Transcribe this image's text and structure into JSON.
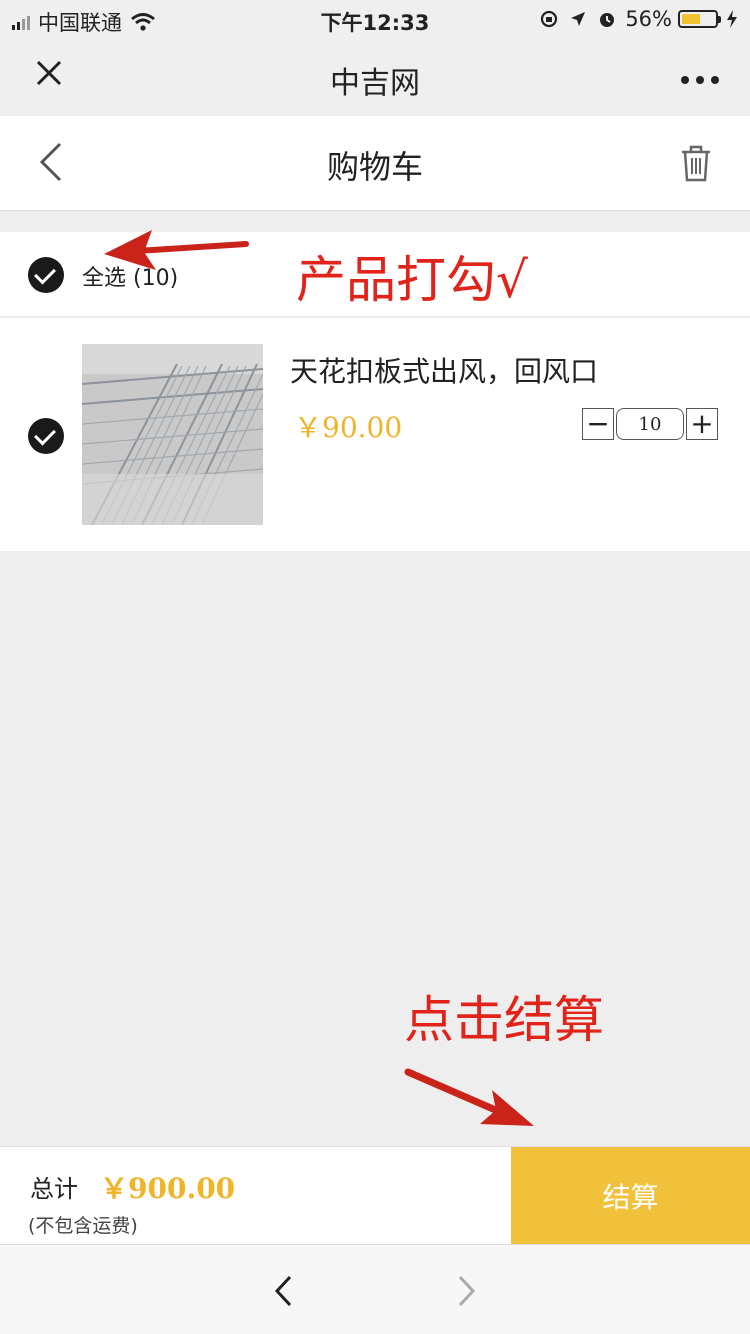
{
  "status_bar": {
    "carrier": "中国联通",
    "time": "下午12:33",
    "battery_percent": "56%",
    "battery_level": 0.56,
    "icons": [
      "signal-icon",
      "wifi-icon",
      "location-icon",
      "alarm-icon",
      "charging-icon"
    ]
  },
  "wechat_bar": {
    "title": "中吉网",
    "close_icon": "close-icon",
    "more_label": "···"
  },
  "nav": {
    "title": "购物车",
    "back_icon": "chevron-left-icon",
    "delete_icon": "trash-icon"
  },
  "cart": {
    "select_all_label": "全选 (10)",
    "items": [
      {
        "name": "天花扣板式出风，回风口",
        "price": "￥90.00",
        "quantity": "10",
        "decrement": "−",
        "increment": "+"
      }
    ]
  },
  "annotations": {
    "select_hint": "产品打勾√",
    "checkout_hint": "点击结算"
  },
  "footer": {
    "total_label": "总计",
    "total_value": "￥900.00",
    "shipping_note": "(不包含运费)",
    "checkout_label": "结算"
  },
  "colors": {
    "accent": "#f2c13c",
    "price": "#f0b429",
    "annotation": "#e2231a"
  }
}
